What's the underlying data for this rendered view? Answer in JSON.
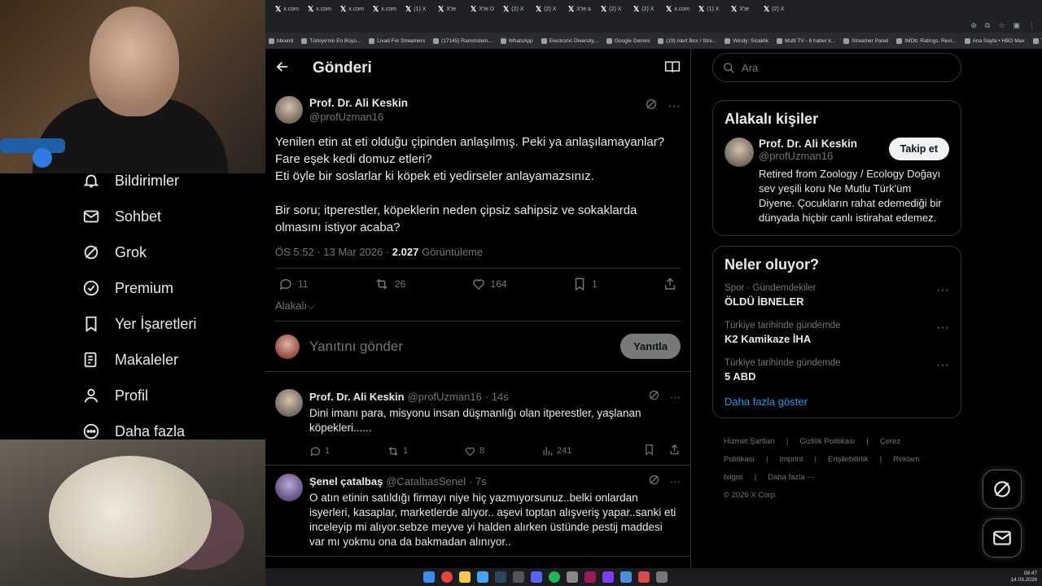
{
  "browser": {
    "tabs": [
      "x.com",
      "x.com",
      "x.com",
      "x.com",
      "(1) X",
      "X'te",
      "X'te D",
      "(2) X",
      "(2) X",
      "X'te a",
      "(2) X",
      "(2) X",
      "x.com",
      "(1) X",
      "X'te",
      "(2) X"
    ],
    "bookmarks": [
      "bboard",
      "Türkiye'nin En Büyü...",
      "Livad For Streamers",
      "(17145) Rammstein...",
      "WhatsApp",
      "Electronic Diversity...",
      "Google Gemini",
      "(19) Alert Box / Stre...",
      "Windy: Sicaklik",
      "Multi TV - 6 haber k...",
      "Streamer Panel",
      "IMDb: Ratings, Revi...",
      "Ana Sayfa • HBO Max",
      "Tüm Yer İşaretleri"
    ]
  },
  "nav": {
    "items": [
      {
        "label": "Bildirimler",
        "icon": "bell-icon"
      },
      {
        "label": "Sohbet",
        "icon": "mail-icon"
      },
      {
        "label": "Grok",
        "icon": "grok-icon"
      },
      {
        "label": "Premium",
        "icon": "verified-icon"
      },
      {
        "label": "Yer İşaretleri",
        "icon": "bookmark-icon"
      },
      {
        "label": "Makaleler",
        "icon": "article-icon"
      },
      {
        "label": "Profil",
        "icon": "person-icon"
      },
      {
        "label": "Daha fazla",
        "icon": "more-circle-icon"
      }
    ]
  },
  "header": {
    "title": "Gönderi"
  },
  "post": {
    "author_name": "Prof. Dr. Ali Keskin",
    "author_handle": "@profUzman16",
    "text": "Yenilen etin at eti olduğu çipinden anlaşılmış. Peki ya anlaşılamayanlar?\nFare eşek kedi domuz etleri?\nEti öyle bir soslarlar ki köpek eti yedirseler anlayamazsınız.\n\nBir soru; itperestler, köpeklerin neden çipsiz sahipsiz ve sokaklarda olmasını istiyor acaba?",
    "time": "ÖS 5:52 · 13 Mar 2026 · ",
    "views_count": "2.027",
    "views_label": "Görüntüleme",
    "replies": "11",
    "reposts": "26",
    "likes": "164",
    "bookmarks": "1",
    "relevance": "Alakalı"
  },
  "reply_box": {
    "placeholder": "Yanıtını gönder",
    "button": "Yanıtla"
  },
  "replies": [
    {
      "name": "Prof. Dr. Ali Keskin",
      "handle": "@profUzman16",
      "age": "· 14s",
      "text": "Dini imanı para, misyonu insan düşmanlığı olan itperestler, yaşlanan köpekleri......",
      "replies": "1",
      "reposts": "1",
      "likes": "8",
      "views": "241"
    },
    {
      "name": "Şenel çatalbaş",
      "handle": "@CatalbasSenel",
      "age": "· 7s",
      "text": "O atın etinin satıldığı firmayı niye hiç yazmıyorsunuz..belki onlardan isyerleri, kasaplar, marketlerde alıyor.. aşevi toptan alışveriş yapar..sanki eti inceleyip mi alıyor.sebze meyve yi halden alırken üstünde pestij maddesi var mı yokmu ona da bakmadan alınıyor.."
    }
  ],
  "search": {
    "placeholder": "Ara"
  },
  "related": {
    "title": "Alakalı kişiler",
    "name": "Prof. Dr. Ali Keskin",
    "handle": "@profUzman16",
    "follow": "Takip et",
    "bio": "Retired from Zoology / Ecology Doğayı sev yeşili koru Ne Mutlu Türk'üm Diyene. Çocukların rahat edemediği bir dünyada hiçbir canlı istirahat edemez."
  },
  "trends": {
    "title": "Neler oluyor?",
    "items": [
      {
        "context": "Spor · Gündemdekiler",
        "topic": "ÖLDÜ İBNELER"
      },
      {
        "context": "Türkiye tarihinde gündemde",
        "topic": "K2 Kamikaze İHA"
      },
      {
        "context": "Türkiye tarihinde gündemde",
        "topic": "5 ABD"
      }
    ],
    "show_more": "Daha fazla göster"
  },
  "footer": {
    "links": [
      "Hizmet Şartları",
      "|",
      "Gizlilik Politikası",
      "|",
      "Çerez Politikası",
      "|",
      "Imprint",
      "|",
      "Erişilebilirlik",
      "|",
      "Reklam bilgisi",
      "|",
      "Daha fazla ···"
    ],
    "copyright": "© 2026 X Corp."
  },
  "taskbar": {
    "time": "08:47",
    "date": "14.03.2026"
  },
  "colors": {
    "accent": "#1d9bf0",
    "bg": "#000000",
    "border": "#2f3336",
    "muted": "#71767b"
  }
}
